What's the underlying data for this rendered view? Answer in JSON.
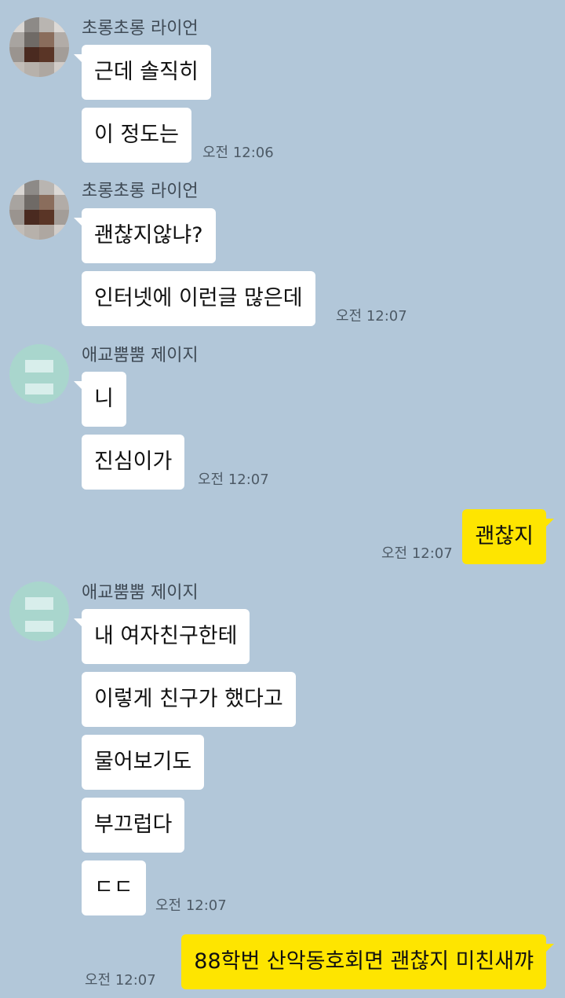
{
  "colors": {
    "background": "#b2c7d9",
    "incoming_bubble": "#ffffff",
    "outgoing_bubble": "#fee500",
    "mint_avatar": "#a9d6cd"
  },
  "messages": [
    {
      "sender": "초롱초롱 라이언",
      "avatar": "pixelated-profile-photo",
      "lines": [
        "근데 솔직히",
        "이 정도는"
      ],
      "time": "오전 12:06"
    },
    {
      "sender": "초롱초롱 라이언",
      "avatar": "pixelated-profile-photo",
      "lines": [
        "괜찮지않냐?",
        "인터넷에 이런글 많은데"
      ],
      "time": "오전 12:07"
    },
    {
      "sender": "애교뿜뿜 제이지",
      "avatar": "jay-g-character-avatar",
      "lines": [
        "니",
        "진심이가"
      ],
      "time": "오전 12:07"
    },
    {
      "sender": "me",
      "lines": [
        "괜찮지"
      ],
      "time": "오전 12:07"
    },
    {
      "sender": "애교뿜뿜 제이지",
      "avatar": "jay-g-character-avatar",
      "lines": [
        "내 여자친구한테",
        "이렇게 친구가 했다고",
        "물어보기도",
        "부끄럽다",
        "ㄷㄷ"
      ],
      "time": "오전 12:07"
    },
    {
      "sender": "me",
      "lines": [
        "88학번 산악동호회면 괜찮지 미친새꺄"
      ],
      "time": "오전 12:07"
    }
  ]
}
